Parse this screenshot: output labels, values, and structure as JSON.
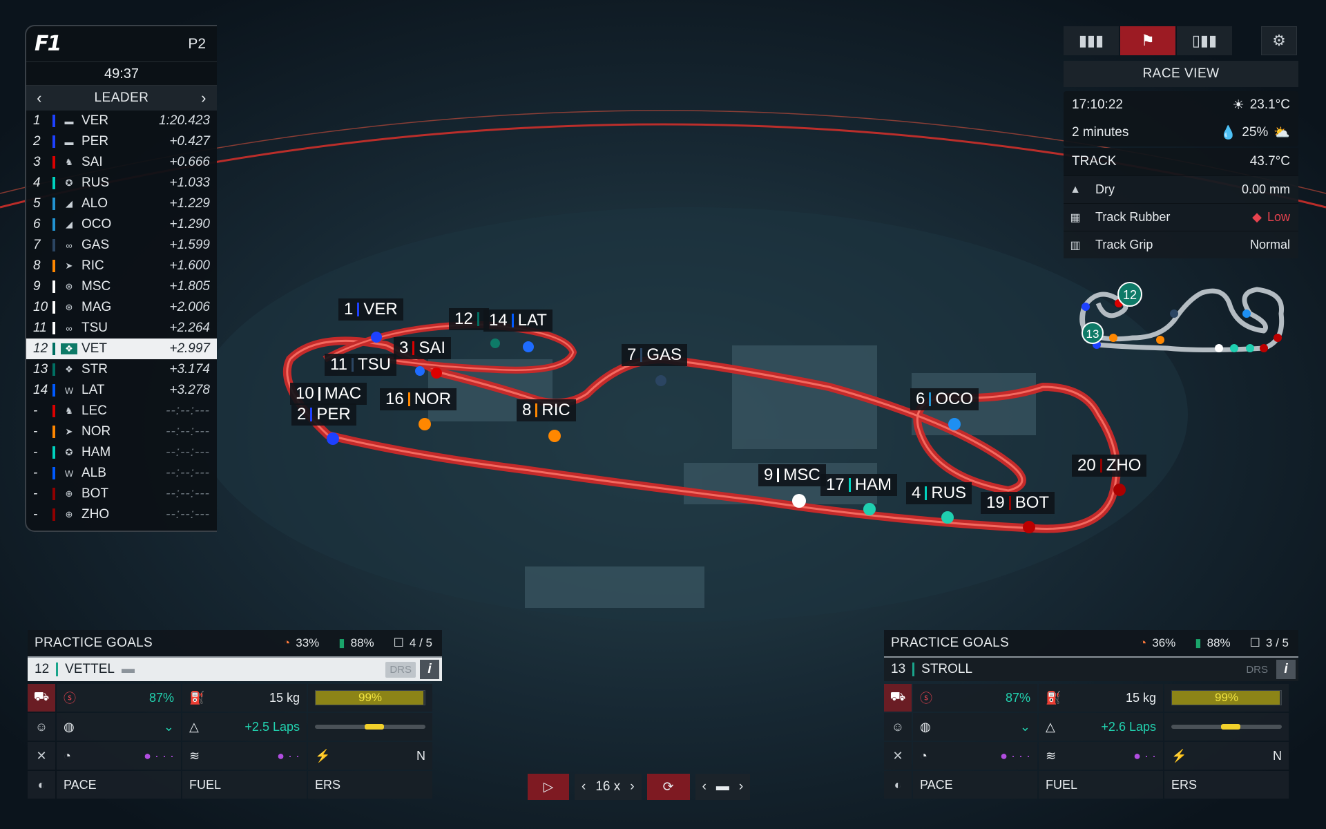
{
  "standings": {
    "logo": "F1",
    "position_badge": "P2",
    "clock": "49:37",
    "mode": "LEADER",
    "rows": [
      {
        "pos": "1",
        "team_color": "#1e41ff",
        "logo": "bull-icon",
        "driver": "VER",
        "gap": "1:20.423"
      },
      {
        "pos": "2",
        "team_color": "#1e41ff",
        "logo": "bull-icon",
        "driver": "PER",
        "gap": "+0.427"
      },
      {
        "pos": "3",
        "team_color": "#dc0000",
        "logo": "horse-icon",
        "driver": "SAI",
        "gap": "+0.666"
      },
      {
        "pos": "4",
        "team_color": "#00d2be",
        "logo": "star-icon",
        "driver": "RUS",
        "gap": "+1.033"
      },
      {
        "pos": "5",
        "team_color": "#2293d1",
        "logo": "alpine-icon",
        "driver": "ALO",
        "gap": "+1.229"
      },
      {
        "pos": "6",
        "team_color": "#2293d1",
        "logo": "alpine-icon",
        "driver": "OCO",
        "gap": "+1.290"
      },
      {
        "pos": "7",
        "team_color": "#2b4562",
        "logo": "at-icon",
        "driver": "GAS",
        "gap": "+1.599"
      },
      {
        "pos": "8",
        "team_color": "#ff8700",
        "logo": "mclaren-icon",
        "driver": "RIC",
        "gap": "+1.600"
      },
      {
        "pos": "9",
        "team_color": "#ffffff",
        "logo": "haas-icon",
        "driver": "MSC",
        "gap": "+1.805"
      },
      {
        "pos": "10",
        "team_color": "#ffffff",
        "logo": "haas-icon",
        "driver": "MAG",
        "gap": "+2.006"
      },
      {
        "pos": "11",
        "team_color": "#ffffff",
        "logo": "at-icon",
        "driver": "TSU",
        "gap": "+2.264"
      },
      {
        "pos": "12",
        "team_color": "#006f62",
        "logo": "aston-icon",
        "driver": "VET",
        "gap": "+2.997",
        "highlight": true
      },
      {
        "pos": "13",
        "team_color": "#006f62",
        "logo": "aston-icon",
        "driver": "STR",
        "gap": "+3.174"
      },
      {
        "pos": "14",
        "team_color": "#005aff",
        "logo": "williams-icon",
        "driver": "LAT",
        "gap": "+3.278"
      },
      {
        "pos": "-",
        "team_color": "#dc0000",
        "logo": "horse-icon",
        "driver": "LEC",
        "gap": "--:--:---"
      },
      {
        "pos": "-",
        "team_color": "#ff8700",
        "logo": "mclaren-icon",
        "driver": "NOR",
        "gap": "--:--:---"
      },
      {
        "pos": "-",
        "team_color": "#00d2be",
        "logo": "star-icon",
        "driver": "HAM",
        "gap": "--:--:---"
      },
      {
        "pos": "-",
        "team_color": "#005aff",
        "logo": "williams-icon",
        "driver": "ALB",
        "gap": "--:--:---"
      },
      {
        "pos": "-",
        "team_color": "#900000",
        "logo": "alfa-icon",
        "driver": "BOT",
        "gap": "--:--:---"
      },
      {
        "pos": "-",
        "team_color": "#900000",
        "logo": "alfa-icon",
        "driver": "ZHO",
        "gap": "--:--:---"
      }
    ]
  },
  "topright": {
    "view_title": "RACE VIEW",
    "time": "17:10:22",
    "air_temp": "23.1°C",
    "forecast": "2 minutes",
    "rain_chance": "25%",
    "track_label": "TRACK",
    "track_temp": "43.7°C",
    "conditions": [
      {
        "icon": "road-icon",
        "label": "Dry",
        "value": "0.00 mm"
      },
      {
        "icon": "tyre-rubber-icon",
        "label": "Track Rubber",
        "value": "Low",
        "warn": true
      },
      {
        "icon": "grip-icon",
        "label": "Track Grip",
        "value": "Normal"
      }
    ]
  },
  "minimap": {
    "markers": [
      "12",
      "13"
    ]
  },
  "track_labels": [
    {
      "num": "1",
      "drv": "VER",
      "color": "#1e41ff"
    },
    {
      "num": "12",
      "drv": "",
      "color": "#006f62"
    },
    {
      "num": "14",
      "drv": "LAT",
      "color": "#005aff"
    },
    {
      "num": "3",
      "drv": "SAI",
      "color": "#dc0000"
    },
    {
      "num": "11",
      "drv": "TSU",
      "color": "#2b4562"
    },
    {
      "num": "7",
      "drv": "GAS",
      "color": "#2b4562"
    },
    {
      "num": "10",
      "drv": "MAC",
      "color": "#ffffff"
    },
    {
      "num": "16",
      "drv": "NOR",
      "color": "#ff8700"
    },
    {
      "num": "2",
      "drv": "PER",
      "color": "#1e41ff"
    },
    {
      "num": "8",
      "drv": "RIC",
      "color": "#ff8700"
    },
    {
      "num": "6",
      "drv": "OCO",
      "color": "#2293d1"
    },
    {
      "num": "20",
      "drv": "ZHO",
      "color": "#900000"
    },
    {
      "num": "9",
      "drv": "MSC",
      "color": "#ffffff"
    },
    {
      "num": "17",
      "drv": "HAM",
      "color": "#00d2be"
    },
    {
      "num": "4",
      "drv": "RUS",
      "color": "#00d2be"
    },
    {
      "num": "19",
      "drv": "BOT",
      "color": "#900000"
    }
  ],
  "panels": [
    {
      "goals_title": "PRACTICE GOALS",
      "tyre_pct": "33%",
      "fuel_pct": "88%",
      "goals": "4 / 5",
      "number": "12",
      "driver": "VETTEL",
      "drs": "DRS",
      "info": "i",
      "tyre_wear": "87%",
      "fuel_kg": "15 kg",
      "ers_pct": "99%",
      "ers_fill": 0.99,
      "fuel_delta": "+2.5 Laps",
      "ers_mode": "N",
      "pace": "PACE",
      "fuel": "FUEL",
      "ers": "ERS",
      "theme": "light"
    },
    {
      "goals_title": "PRACTICE GOALS",
      "tyre_pct": "36%",
      "fuel_pct": "88%",
      "goals": "3 / 5",
      "number": "13",
      "driver": "STROLL",
      "drs": "DRS",
      "info": "i",
      "tyre_wear": "87%",
      "fuel_kg": "15 kg",
      "ers_pct": "99%",
      "ers_fill": 0.99,
      "fuel_delta": "+2.6 Laps",
      "ers_mode": "N",
      "pace": "PACE",
      "fuel": "FUEL",
      "ers": "ERS",
      "theme": "dark"
    }
  ],
  "playback": {
    "speed": "16 x"
  },
  "colors": {
    "accent": "#9c1b23",
    "teal": "#22d3b0",
    "purple": "#b14de0",
    "yellow": "#f2e440"
  }
}
